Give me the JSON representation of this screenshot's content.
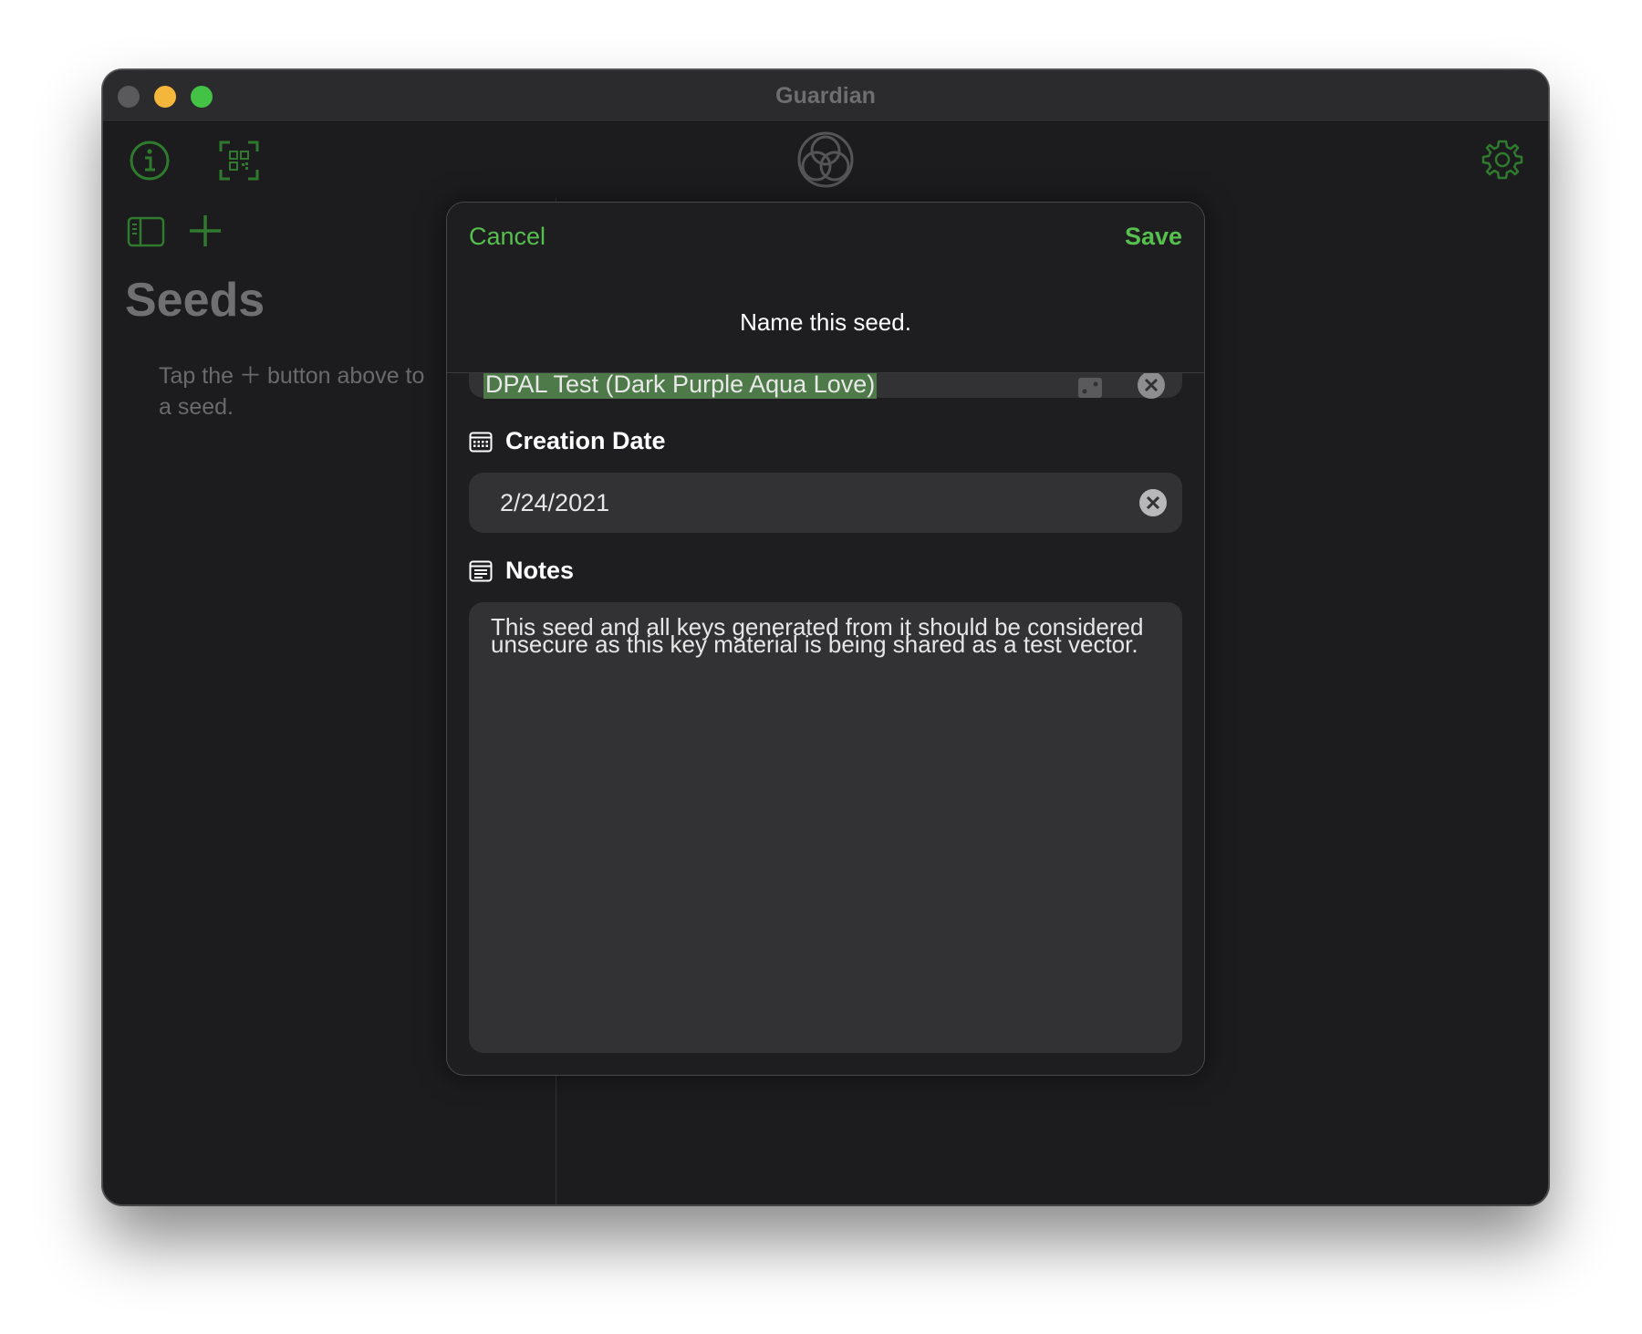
{
  "window": {
    "title": "Guardian"
  },
  "toolbar": {
    "info_icon": "info-circle-icon",
    "scan_icon": "qr-scan-icon",
    "logo_icon": "guardian-logo-icon",
    "settings_icon": "gear-icon",
    "sidebar_toggle_icon": "sidebar-icon",
    "add_icon": "plus-icon"
  },
  "sidebar": {
    "title": "Seeds",
    "hint_prefix": "Tap the",
    "hint_suffix": "button above to",
    "hint_line2": "a seed."
  },
  "sheet": {
    "cancel_label": "Cancel",
    "save_label": "Save",
    "prompt": "Name this seed.",
    "name_value": "DPAL Test (Dark Purple Aqua Love)",
    "creation_date_label": "Creation Date",
    "creation_date_value": "2/24/2021",
    "notes_label": "Notes",
    "notes_value": "This seed and all keys generated from it should be considered unsecure as this key material is being shared as a test vector."
  },
  "colors": {
    "accent": "#56c04f",
    "window_bg": "#1c1c1e",
    "field_bg": "#323234",
    "selection": "#4d7a48"
  }
}
